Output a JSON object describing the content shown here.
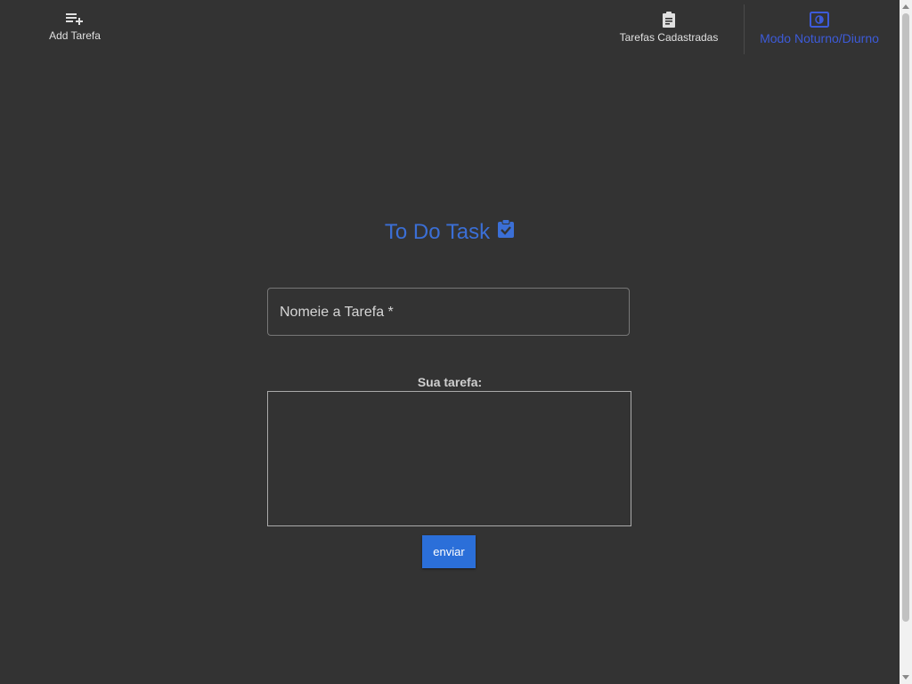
{
  "nav": {
    "add_task": {
      "label": "Add Tarefa",
      "icon": "playlist-add-icon"
    },
    "registered_tasks": {
      "label": "Tarefas Cadastradas",
      "icon": "clipboard-icon"
    },
    "theme_toggle": {
      "label": "Modo Noturno/Diurno",
      "icon": "contrast-icon"
    }
  },
  "main": {
    "title": "To Do Task",
    "title_icon": "clipboard-check-icon",
    "task_name_placeholder": "Nomeie a Tarefa *",
    "task_label": "Sua tarefa:",
    "submit_label": "enviar"
  },
  "colors": {
    "background": "#333333",
    "accent": "#3b6fd6",
    "button": "#2b6fd9",
    "theme_toggle": "#3d5bd9"
  }
}
